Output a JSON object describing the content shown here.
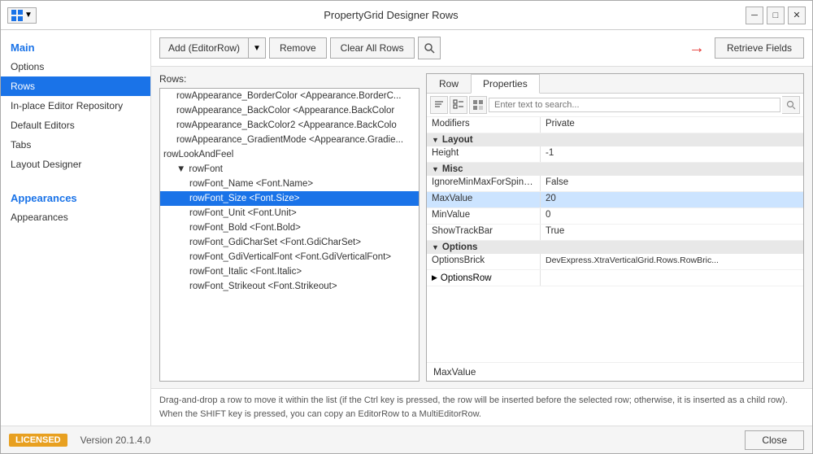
{
  "title": {
    "text": "PropertyGrid Designer Rows",
    "icon": "grid-icon"
  },
  "titlebar": {
    "grid_btn": "⊞",
    "minimize_btn": "─",
    "maximize_btn": "□",
    "close_btn": "✕"
  },
  "sidebar": {
    "main_label": "Main",
    "items": [
      {
        "id": "options",
        "label": "Options",
        "active": false
      },
      {
        "id": "rows",
        "label": "Rows",
        "active": true
      },
      {
        "id": "inplace",
        "label": "In-place Editor Repository",
        "active": false
      },
      {
        "id": "default-editors",
        "label": "Default Editors",
        "active": false
      },
      {
        "id": "tabs",
        "label": "Tabs",
        "active": false
      },
      {
        "id": "layout-designer",
        "label": "Layout Designer",
        "active": false
      }
    ],
    "appearances_label": "Appearances",
    "appearances_items": [
      {
        "id": "appearances",
        "label": "Appearances",
        "active": false
      }
    ]
  },
  "toolbar": {
    "add_btn": "Add (EditorRow)",
    "remove_btn": "Remove",
    "clear_btn": "Clear All Rows",
    "retrieve_btn": "Retrieve Fields",
    "arrow_symbol": "→"
  },
  "rows": {
    "label": "Rows:",
    "items": [
      {
        "id": "r1",
        "label": "rowAppearance_BorderColor <Appearance.BorderC...",
        "indent": 1,
        "selected": false
      },
      {
        "id": "r2",
        "label": "rowAppearance_BackColor <Appearance.BackColor",
        "indent": 1,
        "selected": false
      },
      {
        "id": "r3",
        "label": "rowAppearance_BackColor2 <Appearance.BackColo",
        "indent": 1,
        "selected": false
      },
      {
        "id": "r4",
        "label": "rowAppearance_GradientMode <Appearance.Gradie...",
        "indent": 1,
        "selected": false
      },
      {
        "id": "g1",
        "label": "rowLookAndFeel",
        "indent": 0,
        "selected": false,
        "group": true
      },
      {
        "id": "g2",
        "label": "rowFont",
        "indent": 1,
        "selected": false,
        "group": true
      },
      {
        "id": "r5",
        "label": "rowFont_Name <Font.Name>",
        "indent": 2,
        "selected": false
      },
      {
        "id": "r6",
        "label": "rowFont_Size <Font.Size>",
        "indent": 2,
        "selected": true
      },
      {
        "id": "r7",
        "label": "rowFont_Unit <Font.Unit>",
        "indent": 2,
        "selected": false
      },
      {
        "id": "r8",
        "label": "rowFont_Bold <Font.Bold>",
        "indent": 2,
        "selected": false
      },
      {
        "id": "r9",
        "label": "rowFont_GdiCharSet <Font.GdiCharSet>",
        "indent": 2,
        "selected": false
      },
      {
        "id": "r10",
        "label": "rowFont_GdiVerticalFont <Font.GdiVerticalFont>",
        "indent": 2,
        "selected": false
      },
      {
        "id": "r11",
        "label": "rowFont_Italic <Font.Italic>",
        "indent": 2,
        "selected": false
      },
      {
        "id": "r12",
        "label": "rowFont_Strikeout <Font.Strikeout>",
        "indent": 2,
        "selected": false
      }
    ]
  },
  "properties": {
    "row_tab": "Row",
    "properties_tab": "Properties",
    "search_placeholder": "Enter text to search...",
    "modifiers_row": {
      "key": "Modifiers",
      "value": "Private"
    },
    "sections": [
      {
        "name": "Layout",
        "rows": [
          {
            "key": "Height",
            "value": "-1"
          }
        ]
      },
      {
        "name": "Misc",
        "rows": [
          {
            "key": "IgnoreMinMaxForSpinEdit",
            "value": "False"
          },
          {
            "key": "MaxValue",
            "value": "20",
            "editing": true,
            "highlight": true
          },
          {
            "key": "MinValue",
            "value": "0"
          },
          {
            "key": "ShowTrackBar",
            "value": "True"
          }
        ]
      },
      {
        "name": "Options",
        "rows": [
          {
            "key": "OptionsBrick",
            "value": "DevExpress.XtraVerticalGrid.Rows.RowBric..."
          },
          {
            "key": "OptionsRow",
            "value": ""
          }
        ]
      }
    ],
    "bottom_label": "MaxValue"
  },
  "info": {
    "text": "Drag-and-drop a row to move it within the list (if the Ctrl key is pressed, the row will be inserted before the selected row; otherwise, it is inserted as a child row). When the SHIFT key is pressed, you can copy an EditorRow to a MultiEditorRow."
  },
  "statusbar": {
    "licensed": "LICENSED",
    "version": "Version 20.1.4.0",
    "close": "Close"
  }
}
